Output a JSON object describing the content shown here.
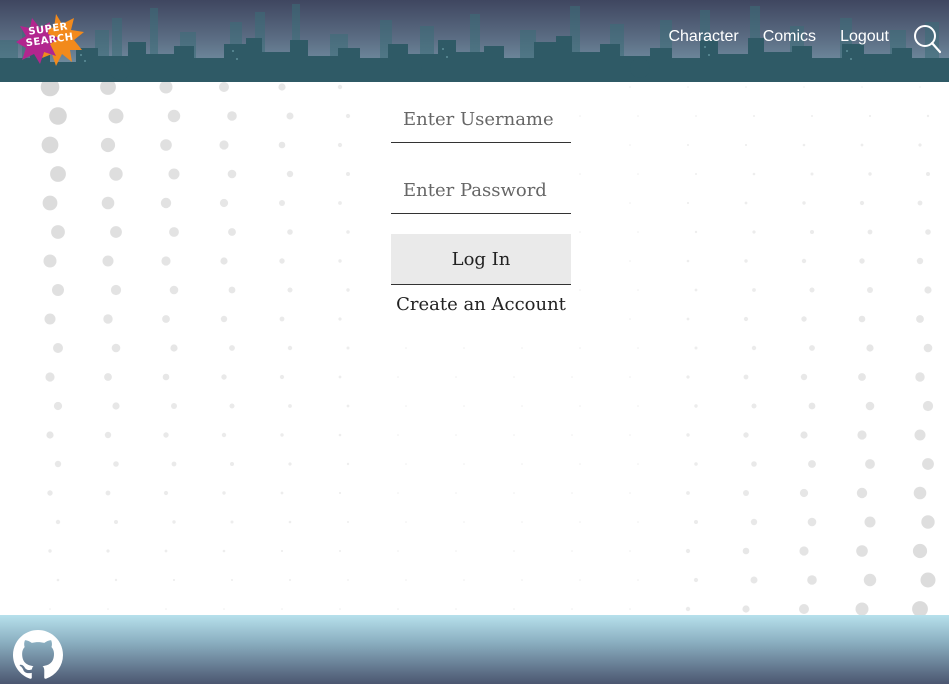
{
  "header": {
    "logo": {
      "line1": "SUPER",
      "line2": "SEARCH"
    },
    "nav": [
      {
        "label": "Character"
      },
      {
        "label": "Comics"
      },
      {
        "label": "Logout"
      }
    ],
    "search_icon": "search-icon"
  },
  "login": {
    "username_placeholder": "Enter Username",
    "password_placeholder": "Enter Password",
    "submit_label": "Log In",
    "create_account_label": "Create an Account"
  },
  "footer": {
    "github_icon": "github-icon"
  },
  "colors": {
    "header_top": "#3f4660",
    "skyline": "#2f5a66",
    "footer_top": "#b7e1ec",
    "footer_bottom": "#4b5670",
    "button_bg": "#eaeaea",
    "dot": "#d0d0d0"
  }
}
